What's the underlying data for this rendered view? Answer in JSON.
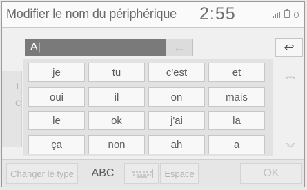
{
  "header": {
    "title": "Modifier le nom du périphérique",
    "clock": "2:55"
  },
  "input": {
    "value": "A|",
    "backspace_icon": "←",
    "back_icon": "↩"
  },
  "suggestions": [
    [
      "je",
      "tu",
      "c'est",
      "et"
    ],
    [
      "oui",
      "il",
      "on",
      "mais"
    ],
    [
      "le",
      "ok",
      "j'ai",
      "la"
    ],
    [
      "ça",
      "non",
      "ah",
      "a"
    ]
  ],
  "scroll": {
    "up_icon": "︽",
    "down_icon": "︾"
  },
  "ghost_left": [
    "1",
    "C"
  ],
  "bottom": {
    "change_type": "Changer le type",
    "abc": "ABC",
    "space": "Espace",
    "ok": "OK"
  }
}
